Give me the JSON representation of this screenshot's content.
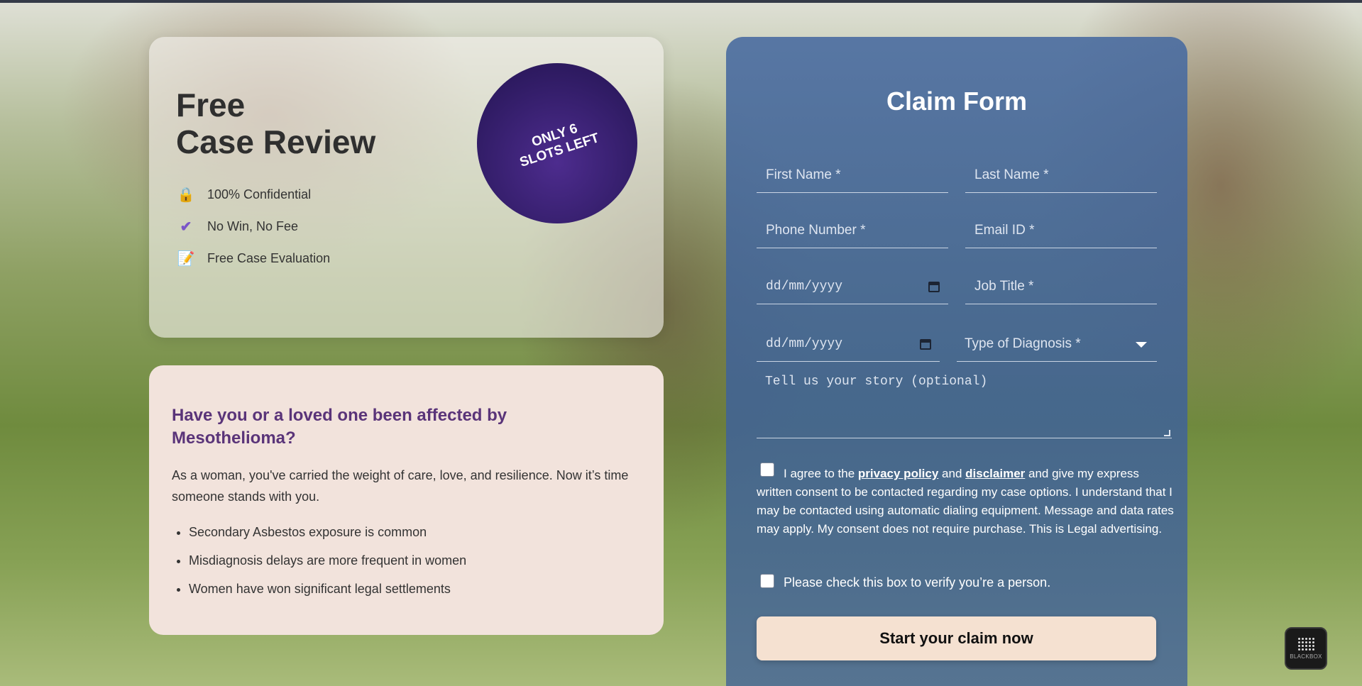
{
  "review": {
    "title_line1": "Free",
    "title_line2": "Case Review",
    "features": [
      {
        "icon": "lock-icon",
        "label": "100% Confidential"
      },
      {
        "icon": "checkmark-icon",
        "label": "No Win, No Fee"
      },
      {
        "icon": "document-icon",
        "label": "Free Case Evaluation"
      }
    ],
    "badge_text": "ONLY 6 SLOTS LEFT"
  },
  "info": {
    "title": "Have you or a loved one been affected by Mesothelioma?",
    "text": "As a woman, you've carried the weight of care, love, and resilience. Now it’s time someone stands with you.",
    "bullets": [
      "Secondary Asbestos exposure is common",
      "Misdiagnosis delays are more frequent in women",
      "Women have won significant legal settlements"
    ]
  },
  "form": {
    "title": "Claim Form",
    "first_name_placeholder": "First Name *",
    "last_name_placeholder": "Last Name *",
    "phone_placeholder": "Phone Number *",
    "email_placeholder": "Email ID *",
    "date1_placeholder": "dd/mm/yyyy",
    "job_title_placeholder": "Job Title *",
    "date2_placeholder": "dd/mm/yyyy",
    "diagnosis_selected": "Type of Diagnosis *",
    "story_placeholder": "Tell us your story (optional)",
    "consent_prefix": "I agree to the",
    "privacy_link": "privacy policy",
    "consent_and": "and",
    "disclaimer_link": "disclaimer",
    "consent_rest": "and give my express written consent to be contacted regarding my case options. I understand that I may be contacted using automatic dialing equipment. Message and data rates may apply. My consent does not require purchase. This is Legal advertising.",
    "verify_label": "Please check this box to verify you’re a person.",
    "submit_label": "Start your claim now"
  },
  "widget": {
    "label": "BLACKBOX"
  },
  "colors": {
    "accent_purple": "#5a3479",
    "form_blue": "#4a6ca0",
    "button_peach": "#f5e1d1",
    "badge_purple": "#2f1b63"
  }
}
